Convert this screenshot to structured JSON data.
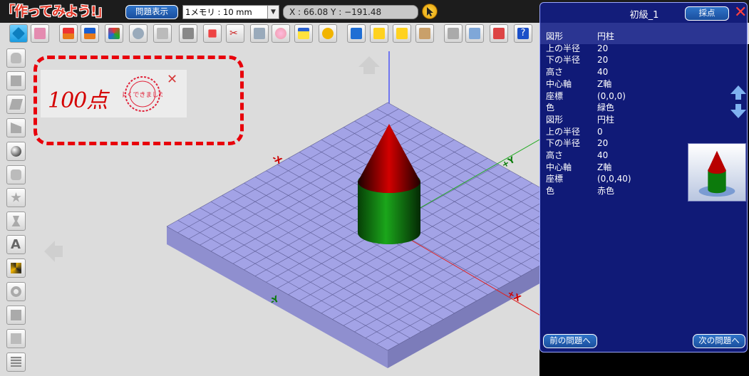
{
  "app": {
    "logo_text": "「作ってみよう!」",
    "question_button": "問題表示",
    "scale_select": "1メモリ : 10 mm",
    "coords": "X : 66.08  Y : −191.48"
  },
  "score": {
    "value_text": "100点",
    "stamp_text": "よくできました"
  },
  "panel": {
    "title": "初級_1",
    "grade_button": "採点",
    "specs": [
      {
        "k": "図形",
        "v": "円柱"
      },
      {
        "k": "上の半径",
        "v": "20"
      },
      {
        "k": "下の半径",
        "v": "20"
      },
      {
        "k": "高さ",
        "v": "40"
      },
      {
        "k": "中心軸",
        "v": "Z軸"
      },
      {
        "k": "座標",
        "v": "(0,0,0)"
      },
      {
        "k": "色",
        "v": "緑色"
      },
      {
        "k": "図形",
        "v": "円柱"
      },
      {
        "k": "上の半径",
        "v": "0"
      },
      {
        "k": "下の半径",
        "v": "20"
      },
      {
        "k": "高さ",
        "v": "40"
      },
      {
        "k": "中心軸",
        "v": "Z軸"
      },
      {
        "k": "座標",
        "v": "(0,0,40)"
      },
      {
        "k": "色",
        "v": "赤色"
      }
    ],
    "prev_button": "前の問題へ",
    "next_button": "次の問題へ"
  },
  "axes": {
    "neg_x": "-X",
    "pos_y": "+Y",
    "neg_y": "-Y",
    "pos_x": "+X"
  },
  "colors": {
    "accent_blue": "#1a4f9e",
    "panel_bg": "#121e87",
    "highlight_red": "#e8000b",
    "grid_fill": "#a3a3e6",
    "cylinder_green": "#0a8a0a",
    "cone_red": "#c00000"
  }
}
